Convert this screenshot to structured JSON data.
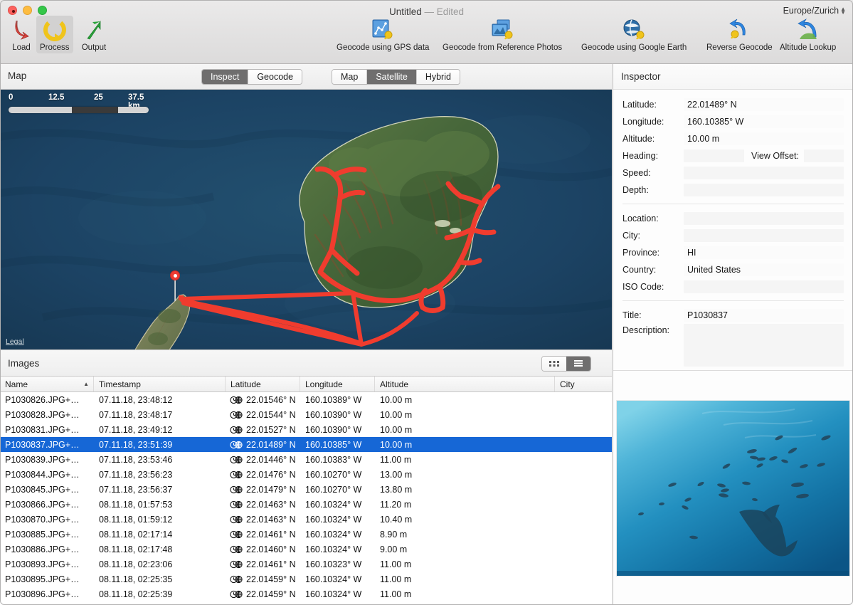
{
  "window": {
    "title": "Untitled",
    "title_separator": "—",
    "edited_label": "Edited",
    "timezone": "Europe/Zurich"
  },
  "toolbar": {
    "items": [
      {
        "label": "Load",
        "icon": "load-arrow-icon",
        "selected": false
      },
      {
        "label": "Process",
        "icon": "process-circle-icon",
        "selected": true
      },
      {
        "label": "Output",
        "icon": "output-arrow-icon",
        "selected": false
      },
      {
        "label": "Geocode using GPS data",
        "icon": "gps-track-pin-icon",
        "selected": false
      },
      {
        "label": "Geocode from Reference Photos",
        "icon": "photos-pin-icon",
        "selected": false
      },
      {
        "label": "Geocode using Google Earth",
        "icon": "globe-pin-icon",
        "selected": false
      },
      {
        "label": "Reverse Geocode",
        "icon": "reverse-arrow-pin-icon",
        "selected": false
      },
      {
        "label": "Altitude Lookup",
        "icon": "altitude-arrow-icon",
        "selected": false
      }
    ]
  },
  "map_panel": {
    "title": "Map",
    "mode_segment": {
      "options": [
        "Inspect",
        "Geocode"
      ],
      "selected": "Inspect"
    },
    "maptype_segment": {
      "options": [
        "Map",
        "Satellite",
        "Hybrid"
      ],
      "selected": "Satellite"
    },
    "zoom_out_icon": "zoom-out-icon",
    "zoom_in_icon": "zoom-in-icon",
    "settings_icon": "gear-icon",
    "scale": {
      "labels": [
        "0",
        "12.5",
        "25",
        "37.5 km"
      ],
      "unit": "km"
    },
    "legal_link": "Legal"
  },
  "images_panel": {
    "title": "Images",
    "view_toggle": {
      "options": [
        "grid-view-icon",
        "list-view-icon"
      ],
      "selected": "list-view-icon"
    },
    "columns": [
      "Name",
      "Timestamp",
      "Latitude",
      "Longitude",
      "Altitude",
      "City"
    ],
    "sort_column": "Name",
    "sort_direction": "ascending",
    "rows": [
      {
        "name": "P1030826.JPG+…",
        "timestamp": "07.11.18, 23:48:12",
        "latitude": "22.01546° N",
        "longitude": "160.10389° W",
        "altitude": "10.00 m",
        "city": "",
        "selected": false
      },
      {
        "name": "P1030828.JPG+…",
        "timestamp": "07.11.18, 23:48:17",
        "latitude": "22.01544° N",
        "longitude": "160.10390° W",
        "altitude": "10.00 m",
        "city": "",
        "selected": false
      },
      {
        "name": "P1030831.JPG+…",
        "timestamp": "07.11.18, 23:49:12",
        "latitude": "22.01527° N",
        "longitude": "160.10390° W",
        "altitude": "10.00 m",
        "city": "",
        "selected": false
      },
      {
        "name": "P1030837.JPG+…",
        "timestamp": "07.11.18, 23:51:39",
        "latitude": "22.01489° N",
        "longitude": "160.10385° W",
        "altitude": "10.00 m",
        "city": "",
        "selected": true
      },
      {
        "name": "P1030839.JPG+…",
        "timestamp": "07.11.18, 23:53:46",
        "latitude": "22.01446° N",
        "longitude": "160.10383° W",
        "altitude": "11.00 m",
        "city": "",
        "selected": false
      },
      {
        "name": "P1030844.JPG+…",
        "timestamp": "07.11.18, 23:56:23",
        "latitude": "22.01476° N",
        "longitude": "160.10270° W",
        "altitude": "13.00 m",
        "city": "",
        "selected": false
      },
      {
        "name": "P1030845.JPG+…",
        "timestamp": "07.11.18, 23:56:37",
        "latitude": "22.01479° N",
        "longitude": "160.10270° W",
        "altitude": "13.80 m",
        "city": "",
        "selected": false
      },
      {
        "name": "P1030866.JPG+…",
        "timestamp": "08.11.18, 01:57:53",
        "latitude": "22.01463° N",
        "longitude": "160.10324° W",
        "altitude": "11.20 m",
        "city": "",
        "selected": false
      },
      {
        "name": "P1030870.JPG+…",
        "timestamp": "08.11.18, 01:59:12",
        "latitude": "22.01463° N",
        "longitude": "160.10324° W",
        "altitude": "10.40 m",
        "city": "",
        "selected": false
      },
      {
        "name": "P1030885.JPG+…",
        "timestamp": "08.11.18, 02:17:14",
        "latitude": "22.01461° N",
        "longitude": "160.10324° W",
        "altitude": "8.90 m",
        "city": "",
        "selected": false
      },
      {
        "name": "P1030886.JPG+…",
        "timestamp": "08.11.18, 02:17:48",
        "latitude": "22.01460° N",
        "longitude": "160.10324° W",
        "altitude": "9.00 m",
        "city": "",
        "selected": false
      },
      {
        "name": "P1030893.JPG+…",
        "timestamp": "08.11.18, 02:23:06",
        "latitude": "22.01461° N",
        "longitude": "160.10323° W",
        "altitude": "11.00 m",
        "city": "",
        "selected": false
      },
      {
        "name": "P1030895.JPG+…",
        "timestamp": "08.11.18, 02:25:35",
        "latitude": "22.01459° N",
        "longitude": "160.10324° W",
        "altitude": "11.00 m",
        "city": "",
        "selected": false
      },
      {
        "name": "P1030896.JPG+…",
        "timestamp": "08.11.18, 02:25:39",
        "latitude": "22.01459° N",
        "longitude": "160.10324° W",
        "altitude": "11.00 m",
        "city": "",
        "selected": false
      }
    ],
    "row_icon": "clock-globe-icon"
  },
  "inspector": {
    "title": "Inspector",
    "fields": {
      "latitude_label": "Latitude:",
      "latitude_value": "22.01489° N",
      "longitude_label": "Longitude:",
      "longitude_value": "160.10385° W",
      "altitude_label": "Altitude:",
      "altitude_value": "10.00 m",
      "heading_label": "Heading:",
      "heading_value": "",
      "view_offset_label": "View Offset:",
      "view_offset_value": "",
      "speed_label": "Speed:",
      "speed_value": "",
      "depth_label": "Depth:",
      "depth_value": "",
      "location_label": "Location:",
      "location_value": "",
      "city_label": "City:",
      "city_value": "",
      "province_label": "Province:",
      "province_value": "HI",
      "country_label": "Country:",
      "country_value": "United States",
      "iso_code_label": "ISO Code:",
      "iso_code_value": "",
      "title_label": "Title:",
      "title_value": "P1030837",
      "description_label": "Description:",
      "description_value": ""
    },
    "preview_icon": "underwater-shark-photo"
  },
  "colors": {
    "selection_blue": "#1667d6",
    "track_red": "#f03c2e",
    "segment_active": "#6f6e6e",
    "ocean": "#1d4260",
    "island_green": "#4e6b3c"
  }
}
